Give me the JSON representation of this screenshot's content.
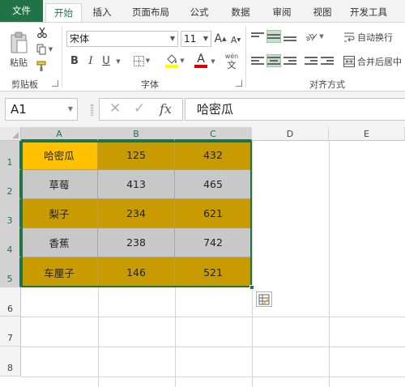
{
  "tabs": [
    {
      "label": "文件"
    },
    {
      "label": "开始"
    },
    {
      "label": "插入"
    },
    {
      "label": "页面布局"
    },
    {
      "label": "公式"
    },
    {
      "label": "数据"
    },
    {
      "label": "审阅"
    },
    {
      "label": "视图"
    },
    {
      "label": "开发工具"
    }
  ],
  "ribbon": {
    "clipboard": {
      "paste_label": "粘贴",
      "group_label": "剪贴板"
    },
    "font": {
      "font_name": "宋体",
      "font_size": "11",
      "bold": "B",
      "italic": "I",
      "underline": "U",
      "grow": "A",
      "shrink": "A",
      "font_color_glyph": "A",
      "phonetic_glyph": "wén",
      "phonetic_sub": "文",
      "group_label": "字体",
      "font_color": "#e00000",
      "fill_color": "#ffff00"
    },
    "alignment": {
      "wrap_text": "自动换行",
      "merge_center": "合并后居中",
      "group_label": "对齐方式"
    }
  },
  "formula_bar": {
    "name_box": "A1",
    "cancel_glyph": "✕",
    "enter_glyph": "✓",
    "fx_label": "fx",
    "formula": "哈密瓜"
  },
  "sheet": {
    "columns": [
      "A",
      "B",
      "C",
      "D",
      "E"
    ],
    "rows": [
      "1",
      "2",
      "3",
      "4",
      "5",
      "6",
      "7",
      "8"
    ],
    "data": [
      [
        "哈密瓜",
        "125",
        "432"
      ],
      [
        "草莓",
        "413",
        "465"
      ],
      [
        "梨子",
        "234",
        "621"
      ],
      [
        "香蕉",
        "238",
        "742"
      ],
      [
        "车厘子",
        "146",
        "521"
      ]
    ],
    "colors": {
      "first_cell": "#ffc000",
      "gold": "#c89b00",
      "gray": "#c8c8c8",
      "selection": "#217346"
    }
  }
}
